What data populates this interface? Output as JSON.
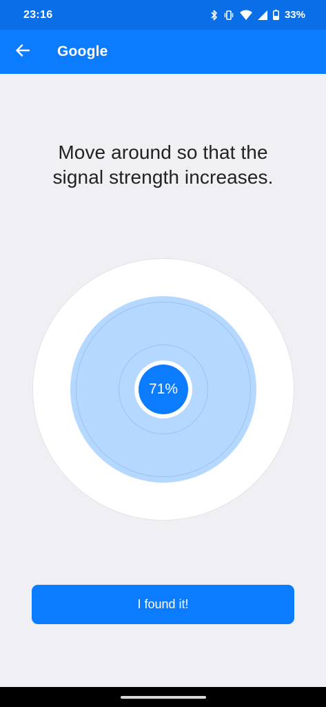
{
  "status_bar": {
    "time": "23:16",
    "battery_percent": "33%",
    "icons": [
      "bluetooth-icon",
      "vibrate-icon",
      "wifi-icon",
      "cell-signal-icon",
      "battery-icon"
    ]
  },
  "app_bar": {
    "title": "Google",
    "back_icon": "arrow-left-icon"
  },
  "instruction": {
    "line1": "Move around so that the",
    "line2": "signal strength increases."
  },
  "signal": {
    "strength_label": "71%",
    "strength_value": 0.71
  },
  "actions": {
    "found_label": "I found it!"
  },
  "colors": {
    "accent": "#0b7bff",
    "status_bar": "#0a6fe6",
    "background": "#efeff4",
    "radar_fill": "#b4d8ff"
  }
}
